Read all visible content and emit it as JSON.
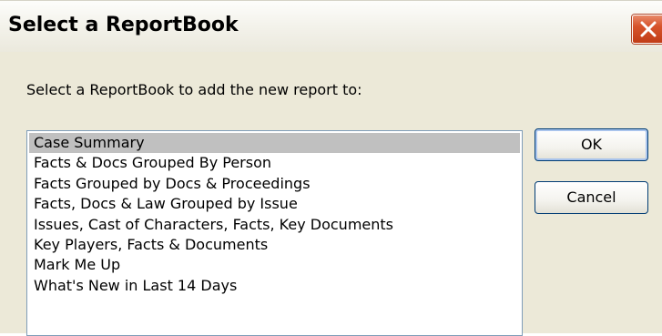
{
  "window": {
    "title": "Select a ReportBook"
  },
  "dialog": {
    "prompt": "Select a ReportBook to add the new report to:",
    "reportbooks": [
      "Case Summary",
      "Facts & Docs Grouped By Person",
      "Facts Grouped by Docs & Proceedings",
      "Facts, Docs & Law Grouped by Issue",
      "Issues, Cast of Characters, Facts, Key Documents",
      "Key Players, Facts & Documents",
      "Mark Me Up",
      "What's New in Last 14 Days"
    ],
    "selected_index": 0,
    "ok_label": "OK",
    "cancel_label": "Cancel"
  },
  "icons": {
    "close": "close-icon"
  },
  "colors": {
    "dialog_background": "#ece9d8",
    "selection": "#c0c0c0",
    "close_button": "#d7542c"
  }
}
